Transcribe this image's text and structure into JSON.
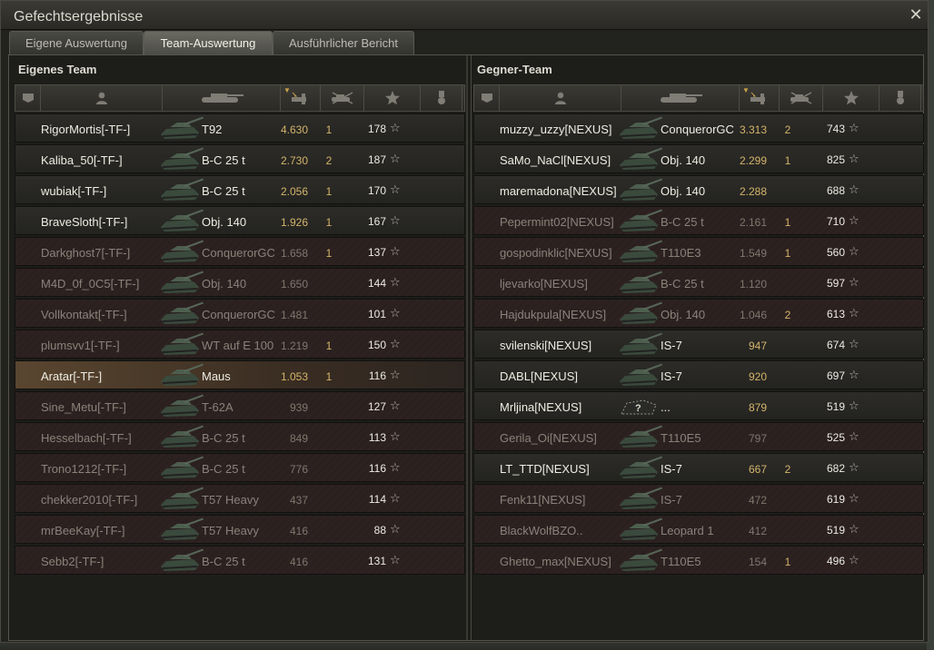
{
  "window": {
    "title": "Gefechtsergebnisse"
  },
  "tabs": [
    {
      "label": "Eigene Auswertung",
      "active": false
    },
    {
      "label": "Team-Auswertung",
      "active": true
    },
    {
      "label": "Ausführlicher Bericht",
      "active": false
    }
  ],
  "columns": [
    "squad-icon",
    "player-icon",
    "tank-icon",
    "damage-icon",
    "kills-icon",
    "xp-star-icon",
    "medal-icon"
  ],
  "own_team": {
    "title": "Eigenes Team",
    "rows": [
      {
        "player": "RigorMortis[-TF-]",
        "tank": "T92",
        "damage": "4.630",
        "kills": "1",
        "xp": "178",
        "alive": true
      },
      {
        "player": "Kaliba_50[-TF-]",
        "tank": "B-C 25 t",
        "damage": "2.730",
        "kills": "2",
        "xp": "187",
        "alive": true
      },
      {
        "player": "wubiak[-TF-]",
        "tank": "B-C 25 t",
        "damage": "2.056",
        "kills": "1",
        "xp": "170",
        "alive": true
      },
      {
        "player": "BraveSloth[-TF-]",
        "tank": "Obj. 140",
        "damage": "1.926",
        "kills": "1",
        "xp": "167",
        "alive": true
      },
      {
        "player": "Darkghost7[-TF-]",
        "tank": "ConquerorGC",
        "damage": "1.658",
        "kills": "1",
        "xp": "137",
        "alive": false
      },
      {
        "player": "M4D_0f_0C5[-TF-]",
        "tank": "Obj. 140",
        "damage": "1.650",
        "kills": "",
        "xp": "144",
        "alive": false
      },
      {
        "player": "Vollkontakt[-TF-]",
        "tank": "ConquerorGC",
        "damage": "1.481",
        "kills": "",
        "xp": "101",
        "alive": false
      },
      {
        "player": "plumsvv1[-TF-]",
        "tank": "WT auf E 100",
        "damage": "1.219",
        "kills": "1",
        "xp": "150",
        "alive": false
      },
      {
        "player": "Aratar[-TF-]",
        "tank": "Maus",
        "damage": "1.053",
        "kills": "1",
        "xp": "116",
        "alive": true,
        "self": true
      },
      {
        "player": "Sine_Metu[-TF-]",
        "tank": "T-62A",
        "damage": "939",
        "kills": "",
        "xp": "127",
        "alive": false
      },
      {
        "player": "Hesselbach[-TF-]",
        "tank": "B-C 25 t",
        "damage": "849",
        "kills": "",
        "xp": "113",
        "alive": false
      },
      {
        "player": "Trono1212[-TF-]",
        "tank": "B-C 25 t",
        "damage": "776",
        "kills": "",
        "xp": "116",
        "alive": false
      },
      {
        "player": "chekker2010[-TF-]",
        "tank": "T57 Heavy",
        "damage": "437",
        "kills": "",
        "xp": "114",
        "alive": false
      },
      {
        "player": "mrBeeKay[-TF-]",
        "tank": "T57 Heavy",
        "damage": "416",
        "kills": "",
        "xp": "88",
        "alive": false
      },
      {
        "player": "Sebb2[-TF-]",
        "tank": "B-C 25 t",
        "damage": "416",
        "kills": "",
        "xp": "131",
        "alive": false
      }
    ]
  },
  "enemy_team": {
    "title": "Gegner-Team",
    "rows": [
      {
        "player": "muzzy_uzzy[NEXUS]",
        "tank": "ConquerorGC",
        "damage": "3.313",
        "kills": "2",
        "xp": "743",
        "alive": true
      },
      {
        "player": "SaMo_NaCl[NEXUS]",
        "tank": "Obj. 140",
        "damage": "2.299",
        "kills": "1",
        "xp": "825",
        "alive": true
      },
      {
        "player": "maremadona[NEXUS]",
        "tank": "Obj. 140",
        "damage": "2.288",
        "kills": "",
        "xp": "688",
        "alive": true
      },
      {
        "player": "Pepermint02[NEXUS]",
        "tank": "B-C 25 t",
        "damage": "2.161",
        "kills": "1",
        "xp": "710",
        "alive": false
      },
      {
        "player": "gospodinklic[NEXUS]",
        "tank": "T110E3",
        "damage": "1.549",
        "kills": "1",
        "xp": "560",
        "alive": false
      },
      {
        "player": "ljevarko[NEXUS]",
        "tank": "B-C 25 t",
        "damage": "1.120",
        "kills": "",
        "xp": "597",
        "alive": false
      },
      {
        "player": "Hajdukpula[NEXUS]",
        "tank": "Obj. 140",
        "damage": "1.046",
        "kills": "2",
        "xp": "613",
        "alive": false
      },
      {
        "player": "svilenski[NEXUS]",
        "tank": "IS-7",
        "damage": "947",
        "kills": "",
        "xp": "674",
        "alive": true
      },
      {
        "player": "DABL[NEXUS]",
        "tank": "IS-7",
        "damage": "920",
        "kills": "",
        "xp": "697",
        "alive": true
      },
      {
        "player": "Mrljina[NEXUS]",
        "tank": "...",
        "damage": "879",
        "kills": "",
        "xp": "519",
        "alive": true,
        "unknown": true
      },
      {
        "player": "Gerila_Oi[NEXUS]",
        "tank": "T110E5",
        "damage": "797",
        "kills": "",
        "xp": "525",
        "alive": false
      },
      {
        "player": "LT_TTD[NEXUS]",
        "tank": "IS-7",
        "damage": "667",
        "kills": "2",
        "xp": "682",
        "alive": true
      },
      {
        "player": "Fenk11[NEXUS]",
        "tank": "IS-7",
        "damage": "472",
        "kills": "",
        "xp": "619",
        "alive": false
      },
      {
        "player": "BlackWolfBZO..",
        "tank": "Leopard 1",
        "damage": "412",
        "kills": "",
        "xp": "519",
        "alive": false
      },
      {
        "player": "Ghetto_max[NEXUS]",
        "tank": "T110E5",
        "damage": "154",
        "kills": "1",
        "xp": "496",
        "alive": false
      }
    ]
  },
  "colors": {
    "damage": "#d4b46a",
    "dead_row": "#2e2221",
    "self_row": "#5a4630"
  }
}
